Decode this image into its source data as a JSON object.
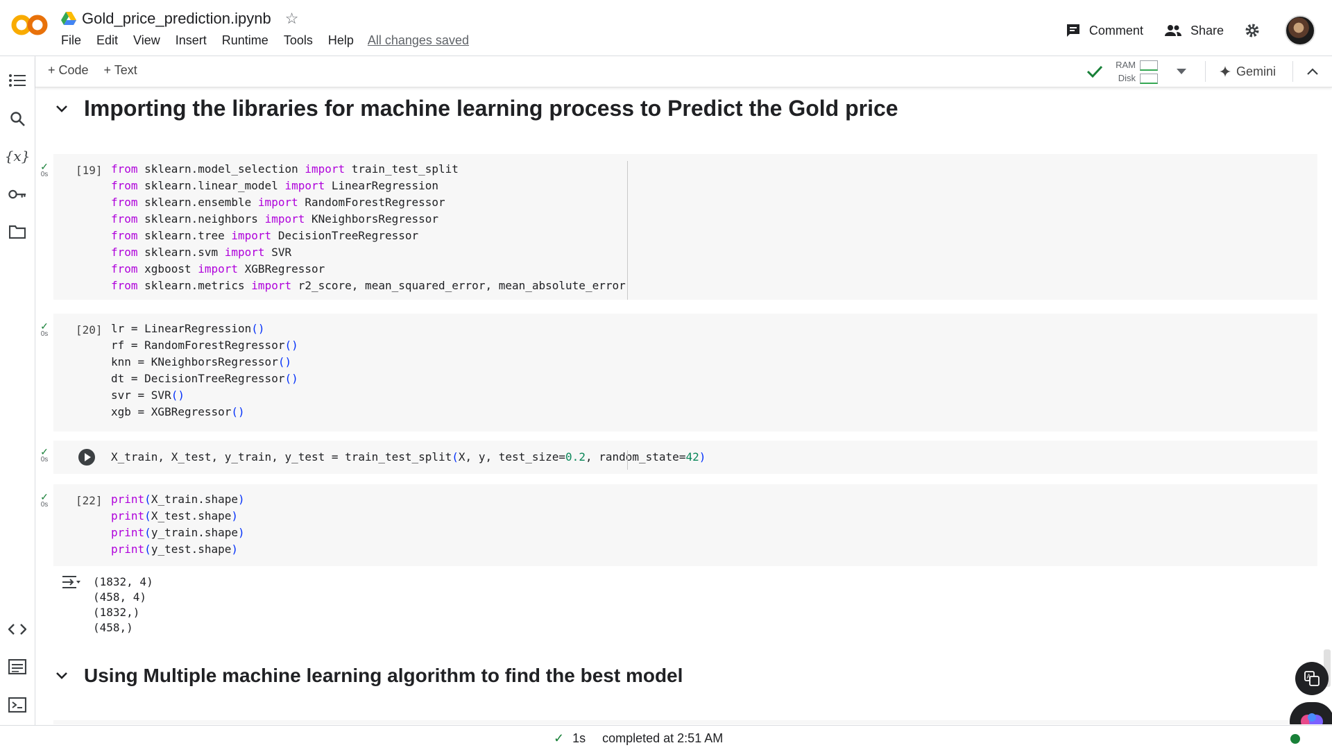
{
  "header": {
    "doc_title": "Gold_price_prediction.ipynb",
    "menu": [
      "File",
      "Edit",
      "View",
      "Insert",
      "Runtime",
      "Tools",
      "Help"
    ],
    "saved_status": "All changes saved",
    "comment_label": "Comment",
    "share_label": "Share"
  },
  "toolbar": {
    "add_code": "+ Code",
    "add_text": "+ Text",
    "ram_label": "RAM",
    "disk_label": "Disk",
    "gemini_label": "Gemini"
  },
  "sections": {
    "s1": "Importing the libraries for machine learning process to Predict the Gold price",
    "s2": "Using Multiple machine learning algorithm to find the best model"
  },
  "cells": [
    {
      "exec": "[19]",
      "time": "0s"
    },
    {
      "exec": "[20]",
      "time": "0s"
    },
    {
      "exec": "",
      "time": "0s"
    },
    {
      "exec": "[22]",
      "time": "0s"
    }
  ],
  "output": [
    "(1832, 4)",
    "(458, 4)",
    "(1832,)",
    "(458,)"
  ],
  "status": {
    "duration": "1s",
    "message": "completed at 2:51 AM"
  },
  "colors": {
    "keyword": "#af00db",
    "bracket": "#0431fa",
    "number": "#098658",
    "success": "#188038"
  }
}
